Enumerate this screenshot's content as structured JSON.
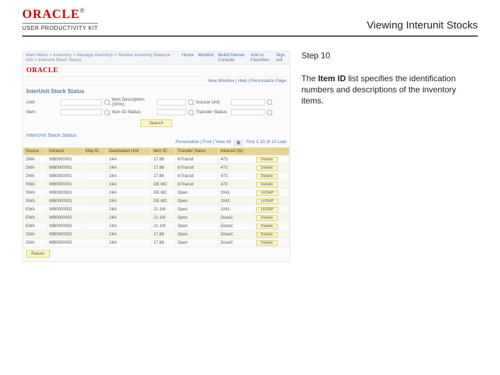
{
  "header": {
    "brand": "ORACLE",
    "subtitle": "USER PRODUCTIVITY KIT",
    "page_title": "Viewing Interunit Stocks"
  },
  "instruction": {
    "step_label": "Step 10",
    "body_before": "The ",
    "body_bold": "Item ID",
    "body_after": " list specifies the identification numbers and descriptions of the inventory items."
  },
  "shot": {
    "breadcrumb_left": "Main Menu > Inventory > Manage Inventory > Review Inventory Balance Info > Interunit Stock Status",
    "nav_links": [
      "Home",
      "Worklist",
      "MultiChannel Console",
      "Add to Favorites",
      "Sign out"
    ],
    "brand_mini": "ORACLE",
    "meta_right": "New Window | Help | Personalize Page",
    "section_title": "InterUnit Stock Status",
    "filters": [
      {
        "label": "Unit:",
        "value": "",
        "after_label": "Item Description (30%):",
        "after_value": "",
        "third_label": "Source Unit:",
        "third_value": ""
      },
      {
        "label": "Item:",
        "value": "",
        "after_label": "Item ID Status:",
        "after_value": "",
        "third_label": "Transfer Status:",
        "third_value": ""
      }
    ],
    "search_button": "Search",
    "sub_title": "InterUnit Stock Status",
    "toolbar": {
      "personalize": "Personalize | Find | View All",
      "grid_icon": "▦",
      "page_info": "First 1-10 of 10 Last"
    },
    "columns": [
      "Source",
      "Intransit",
      "Ship ID",
      "Destination Unit",
      "Item ID",
      "Transfer Status",
      "Intransit Qty",
      ""
    ],
    "rows": [
      {
        "c": [
          "2WA",
          "WB0000001",
          "",
          "24A",
          "17.88",
          "InTransit",
          "473",
          "Details"
        ],
        "alt": false
      },
      {
        "c": [
          "2WA",
          "WB0000001",
          "",
          "24A",
          "17.88",
          "InTransit",
          "473",
          "Details"
        ],
        "alt": true
      },
      {
        "c": [
          "2WA",
          "WB0000001",
          "",
          "24A",
          "17.88",
          "InTransit",
          "473",
          "Details"
        ],
        "alt": false
      },
      {
        "c": [
          "SWA",
          "WB0000001",
          "",
          "24A",
          "DE-MC",
          "InTransit",
          "473",
          "Details"
        ],
        "alt": true
      },
      {
        "c": [
          "SWA",
          "WB0000001",
          "",
          "24A",
          "DE-MC",
          "Open",
          "1041",
          "LKSHP"
        ],
        "alt": false
      },
      {
        "c": [
          "SWA",
          "WB0000001",
          "",
          "24A",
          "DE-MC",
          "Open",
          "1041",
          "LKSHP"
        ],
        "alt": true
      },
      {
        "c": [
          "EWA",
          "WB0000002",
          "",
          "24A",
          "21-1M",
          "Open",
          "1041",
          "LKSHP"
        ],
        "alt": false
      },
      {
        "c": [
          "EWA",
          "WB0000002",
          "",
          "24A",
          "21-1M",
          "Open",
          "DoseC",
          "Details"
        ],
        "alt": true
      },
      {
        "c": [
          "EWA",
          "WB0000002",
          "",
          "24A",
          "21-1M",
          "Open",
          "DoseC",
          "Details"
        ],
        "alt": false
      },
      {
        "c": [
          "2WA",
          "WB0000002",
          "",
          "24A",
          "17.88",
          "Open",
          "DoseC",
          "Details"
        ],
        "alt": true
      },
      {
        "c": [
          "2WA",
          "WB0000002",
          "",
          "24A",
          "17.88",
          "Open",
          "DoseC",
          "Details"
        ],
        "alt": false
      }
    ],
    "footer_button": "Return"
  }
}
